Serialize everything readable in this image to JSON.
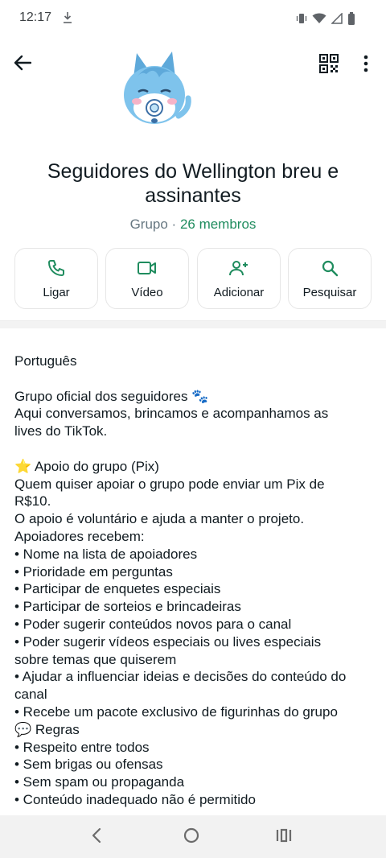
{
  "status_bar": {
    "time": "12:17"
  },
  "header": {
    "group_name": "Seguidores do Wellington breu  e assinantes",
    "group_type": "Grupo",
    "separator": " · ",
    "members": "26 membros"
  },
  "actions": [
    {
      "label": "Ligar",
      "icon": "phone-icon"
    },
    {
      "label": "Vídeo",
      "icon": "video-icon"
    },
    {
      "label": "Adicionar",
      "icon": "add-person-icon"
    },
    {
      "label": "Pesquisar",
      "icon": "search-icon"
    }
  ],
  "colors": {
    "accent": "#1f8c5e",
    "text": "#111b21",
    "muted": "#667781"
  },
  "description": {
    "lines": [
      "Português",
      "",
      "Grupo oficial dos seguidores 🐾",
      "Aqui conversamos, brincamos e acompanhamos as",
      "lives do TikTok.",
      "",
      "⭐ Apoio do grupo (Pix)",
      "Quem quiser apoiar o grupo pode enviar um Pix de",
      "R$10.",
      "O apoio é voluntário e ajuda a manter o projeto.",
      "Apoiadores recebem:",
      "• Nome na lista de apoiadores",
      "• Prioridade em perguntas",
      "• Participar de enquetes especiais",
      "• Participar de sorteios e brincadeiras",
      "• Poder sugerir conteúdos novos para o canal",
      "• Poder sugerir vídeos especiais ou lives especiais",
      "sobre temas que quiserem",
      "• Ajudar a influenciar ideias e decisões do conteúdo do",
      "canal",
      "• Recebe um pacote exclusivo de figurinhas do grupo",
      "💬 Regras",
      "• Respeito entre todos",
      "• Sem brigas ou ofensas",
      "• Sem spam ou propaganda",
      "• Conteúdo inadequado não é permitido"
    ]
  }
}
